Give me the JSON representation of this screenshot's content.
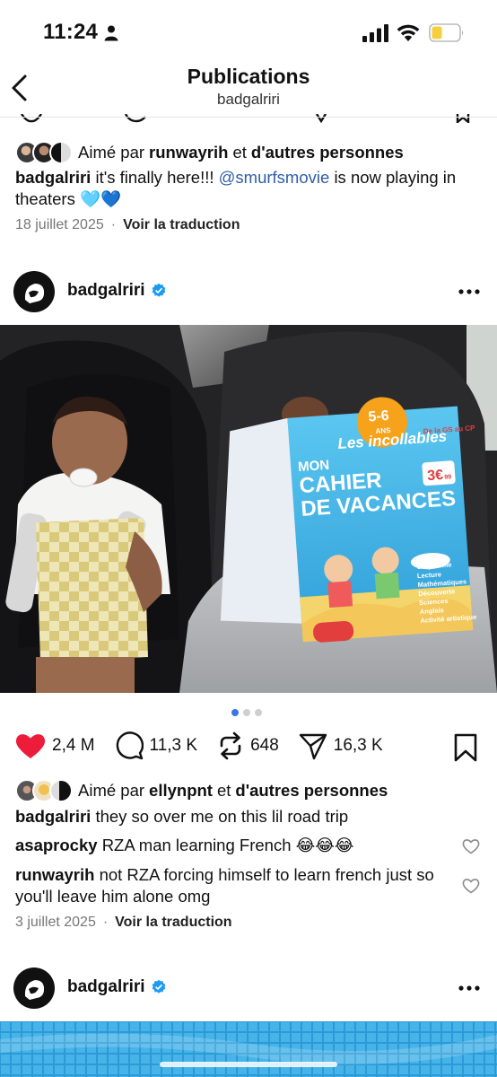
{
  "status": {
    "time": "11:24"
  },
  "header": {
    "title": "Publications",
    "subtitle": "badgalriri"
  },
  "prev_post": {
    "liked_prefix": "Aimé par",
    "liked_by": "runwayrih",
    "liked_and": "et",
    "liked_others": "d'autres personnes",
    "caption_user": "badgalriri",
    "caption_text_1": "it's finally here!!!",
    "caption_mention": "@smurfsmovie",
    "caption_text_2": "is now playing in theaters 🩵💙",
    "date": "18 juillet 2025",
    "translate": "Voir la traduction"
  },
  "post": {
    "username": "badgalriri",
    "pager_count": 3,
    "pager_active": 0,
    "stats": {
      "likes": "2,4 M",
      "comments": "11,3 K",
      "reposts": "648",
      "shares": "16,3 K"
    },
    "liked_prefix": "Aimé par",
    "liked_by": "ellynpnt",
    "liked_and": "et",
    "liked_others": "d'autres personnes",
    "caption_user": "badgalriri",
    "caption_text": "they so over me on this lil road trip",
    "comments": [
      {
        "user": "asaprocky",
        "text": "RZA man learning French 😂😂😂"
      },
      {
        "user": "runwayrih",
        "text": "not RZA forcing himself to learn french just so you'll leave him alone omg"
      }
    ],
    "date": "3 juillet 2025",
    "translate": "Voir la traduction"
  },
  "next_post": {
    "username": "badgalriri"
  },
  "book": {
    "ages": "5-6",
    "ans": "ANS",
    "brand": "Les incollables",
    "title_1": "MON",
    "title_2": "CAHIER",
    "title_3": "DE VACANCES",
    "grade": "De la GS au CP",
    "price": "3€",
    "price_cents": "99",
    "subjects": [
      "Graphisme",
      "Lecture",
      "Mathématiques",
      "Découverte",
      "Sciences",
      "Anglais",
      "Activité artistique"
    ]
  },
  "colors": {
    "accent": "#3b76e6",
    "heart": "#ed1c3b",
    "verified": "#1d9bf0",
    "mention": "#2f5da6"
  }
}
